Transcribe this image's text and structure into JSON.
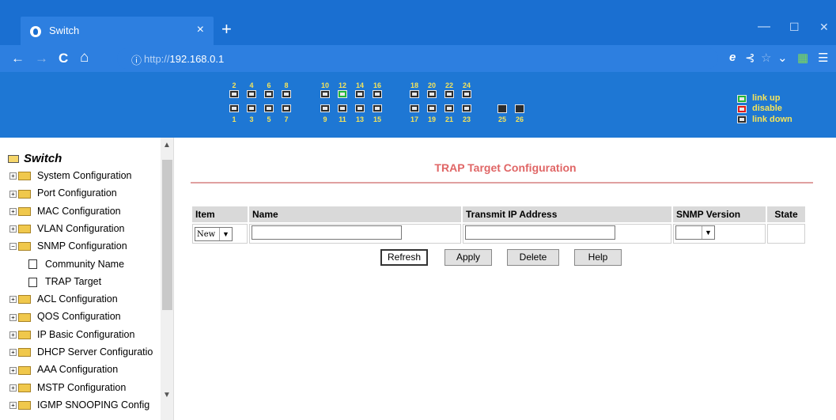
{
  "browser": {
    "tab_title": "Switch",
    "tab_close": "×",
    "new_tab": "+",
    "url_prefix": "http://",
    "url_host": "192.168.0.1",
    "window_controls": [
      "—",
      "☐",
      "✕"
    ],
    "nav": {
      "back": "←",
      "forward": "→",
      "reload": "C",
      "home": "⌂",
      "info": "ⓘ"
    },
    "right_tools": [
      "e",
      "⊰",
      "☆",
      "⌄",
      "▦",
      "☰"
    ]
  },
  "banner": {
    "top_port_numbers": [
      "2",
      "4",
      "6",
      "8",
      "10",
      "12",
      "14",
      "16",
      "18",
      "20",
      "22",
      "24"
    ],
    "bottom_port_numbers": [
      "1",
      "3",
      "5",
      "7",
      "9",
      "11",
      "13",
      "15",
      "17",
      "19",
      "21",
      "23"
    ],
    "sfp_port_numbers": [
      "25",
      "26"
    ],
    "port_status": {
      "12": "link-up"
    },
    "legend": {
      "up": "link up",
      "disable": "disable",
      "down": "link down"
    },
    "colors": {
      "link_up": "#21b63a",
      "disable": "#e21a1a",
      "link_down": "#2b2b2b",
      "label": "#f5e45a",
      "bg": "#1e77d4"
    }
  },
  "sidebar": {
    "root": "Switch",
    "items": [
      {
        "label": "System Configuration"
      },
      {
        "label": "Port Configuration"
      },
      {
        "label": "MAC Configuration"
      },
      {
        "label": "VLAN Configuration"
      },
      {
        "label": "SNMP Configuration",
        "expanded": true
      },
      {
        "label": "Community Name",
        "child": true
      },
      {
        "label": "TRAP Target",
        "child": true
      },
      {
        "label": "ACL Configuration"
      },
      {
        "label": "QOS Configuration"
      },
      {
        "label": "IP Basic Configuration"
      },
      {
        "label": "DHCP Server Configuratio"
      },
      {
        "label": "AAA Configuration"
      },
      {
        "label": "MSTP Configuration"
      },
      {
        "label": "IGMP SNOOPING Config"
      }
    ],
    "tree_plus": "+",
    "tree_minus": "−"
  },
  "main": {
    "title": "TRAP Target Configuration",
    "columns": [
      "Item",
      "Name",
      "Transmit IP Address",
      "SNMP Version",
      "State"
    ],
    "row": {
      "item_value": "New",
      "name_value": "",
      "ip_value": "",
      "version_value": ""
    },
    "buttons": {
      "refresh": "Refresh",
      "apply": "Apply",
      "delete": "Delete",
      "help": "Help"
    },
    "title_color": "#e06666"
  }
}
